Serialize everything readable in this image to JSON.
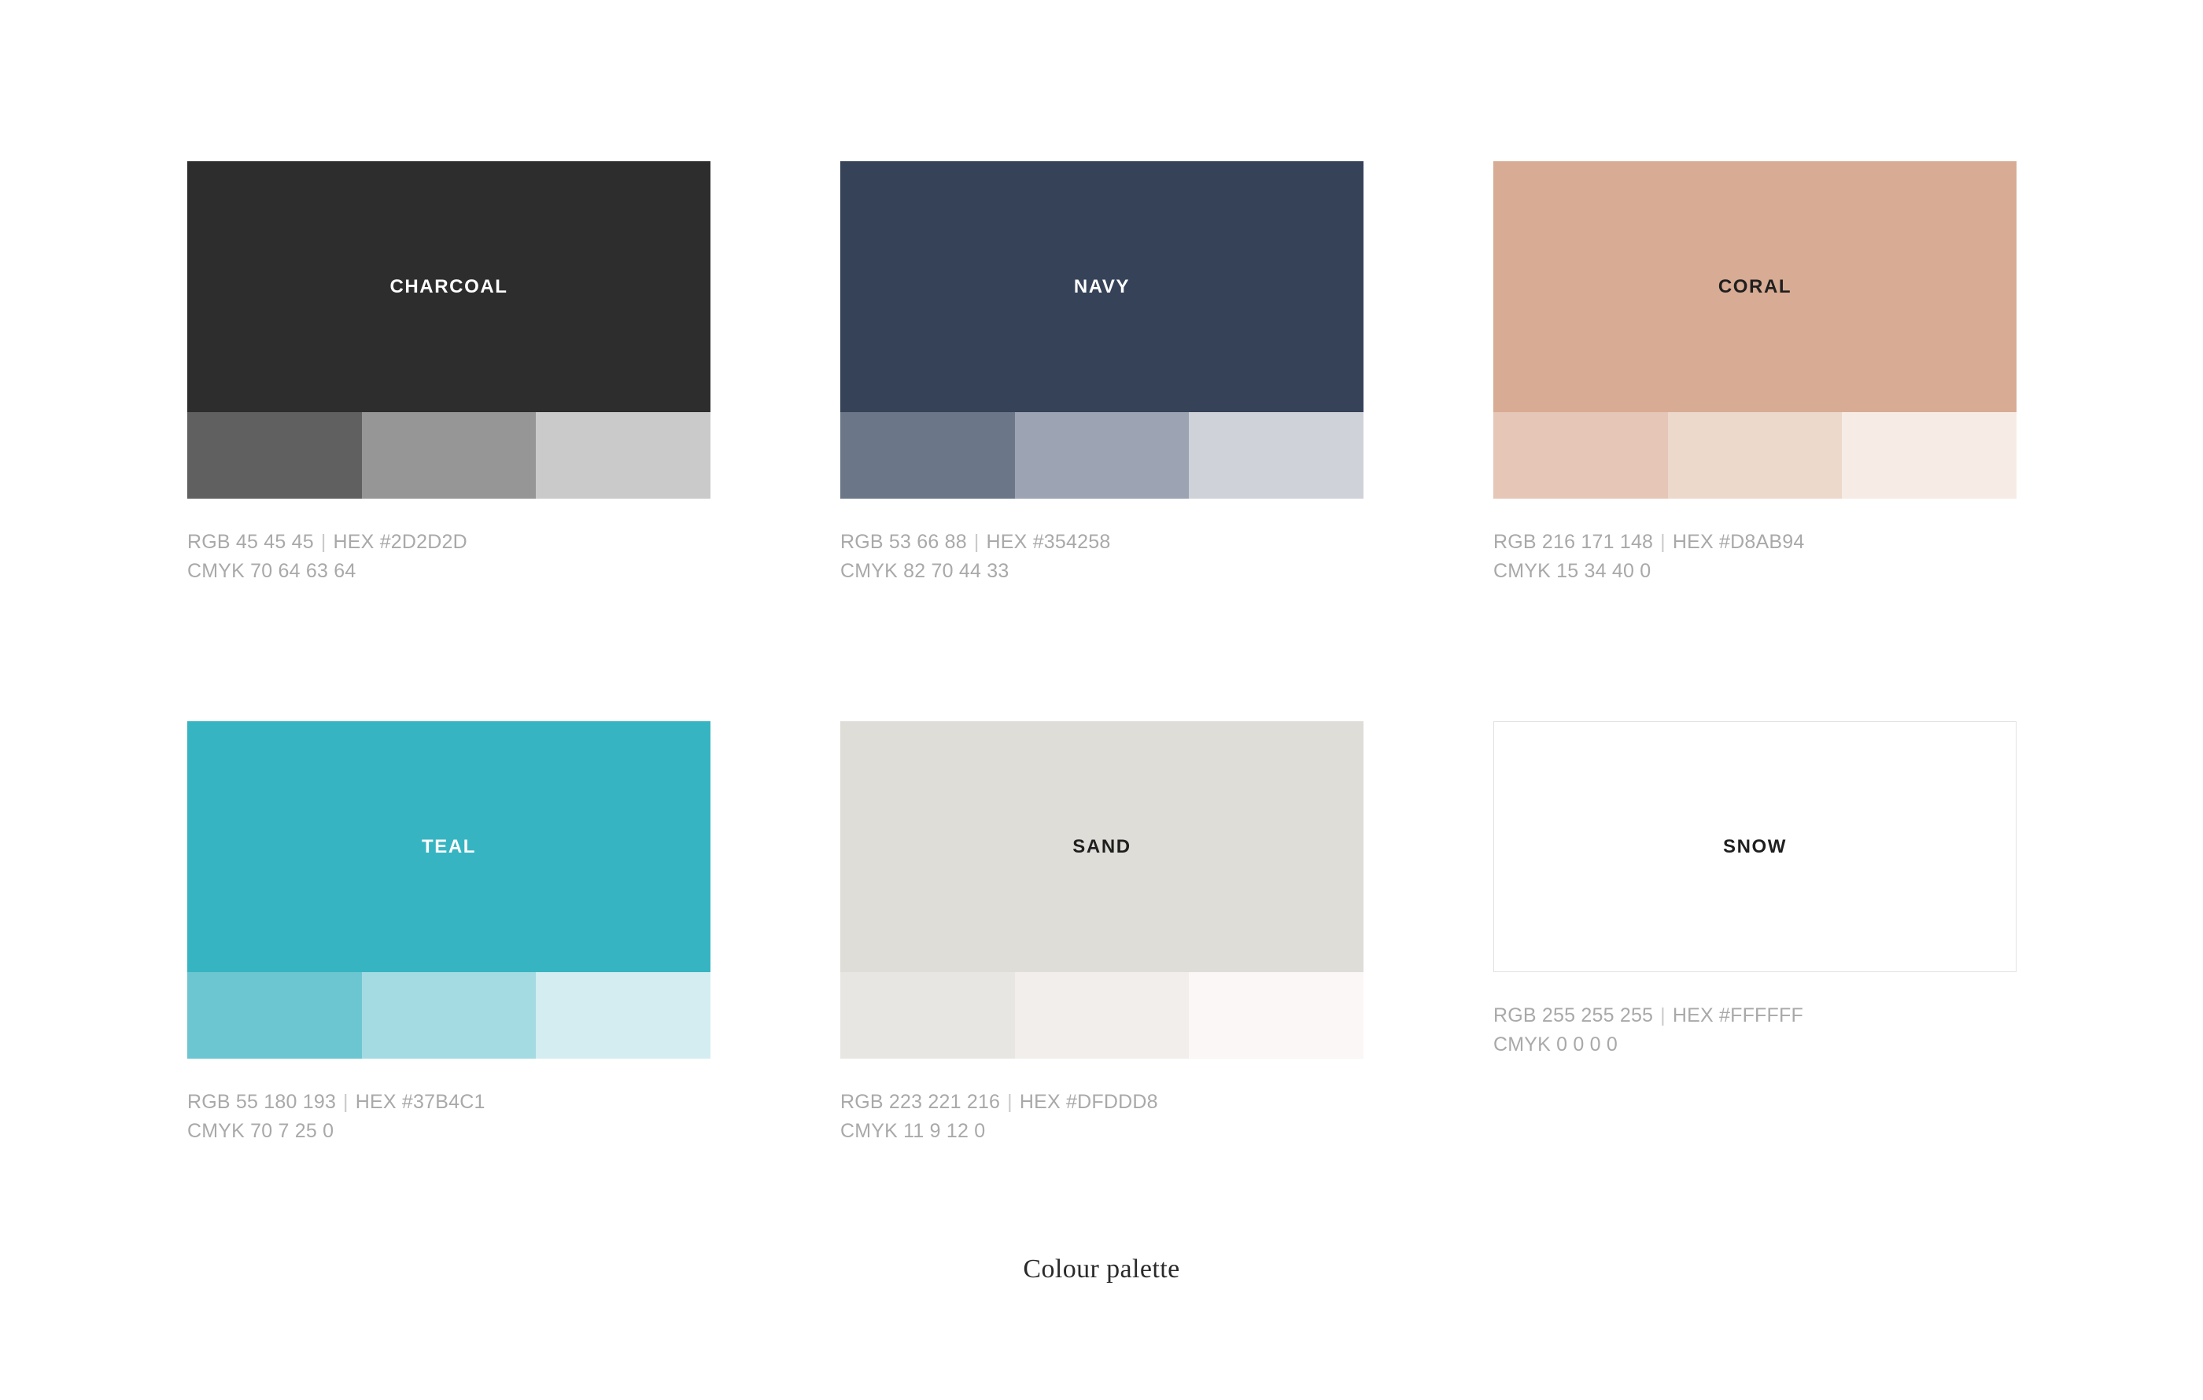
{
  "footer": {
    "caption": "Colour palette"
  },
  "palette": {
    "swatches": [
      {
        "name": "CHARCOAL",
        "main_hex": "#2D2D2D",
        "label_color": "#FFFFFF",
        "outlined": false,
        "tints": [
          "#606060",
          "#969696",
          "#CACACA"
        ],
        "rgb_label": "RGB 45 45 45",
        "hex_label": "HEX #2D2D2D",
        "cmyk_label": "CMYK 70 64 63 64",
        "divider": "|"
      },
      {
        "name": "NAVY",
        "main_hex": "#354258",
        "label_color": "#FFFFFF",
        "outlined": false,
        "tints": [
          "#6B7789",
          "#9CA3B2",
          "#CFD2D9"
        ],
        "rgb_label": "RGB 53 66 88",
        "hex_label": "HEX #354258",
        "cmyk_label": "CMYK 82 70 44 33",
        "divider": "|"
      },
      {
        "name": "CORAL",
        "main_hex": "#D8AB94",
        "label_color": "#1F1F1F",
        "outlined": false,
        "tints": [
          "#E5C6B7",
          "#EDD8CC",
          "#F7EBE5"
        ],
        "rgb_label": "RGB 216 171 148",
        "hex_label": "HEX #D8AB94",
        "cmyk_label": "CMYK 15 34 40 0",
        "divider": "|"
      },
      {
        "name": "TEAL",
        "main_hex": "#37B4C1",
        "label_color": "#FFFFFF",
        "outlined": false,
        "tints": [
          "#6CC6D2",
          "#A4DBE2",
          "#D3EDF1"
        ],
        "rgb_label": "RGB 55 180 193",
        "hex_label": "HEX #37B4C1",
        "cmyk_label": "CMYK 70 7 25 0",
        "divider": "|"
      },
      {
        "name": "SAND",
        "main_hex": "#DFDDD8",
        "label_color": "#1F1F1F",
        "outlined": false,
        "tints": [
          "#E8E6E3",
          "#F1EEEC",
          "#FAF7F6"
        ],
        "rgb_label": "RGB 223 221 216",
        "hex_label": "HEX #DFDDD8",
        "cmyk_label": "CMYK 11 9 12 0",
        "divider": "|"
      },
      {
        "name": "SNOW",
        "main_hex": "#FFFFFF",
        "label_color": "#1F1F1F",
        "outlined": true,
        "border_color": "#E2E2E2",
        "tints": [],
        "rgb_label": "RGB 255 255 255",
        "hex_label": "HEX #FFFFFF",
        "cmyk_label": "CMYK 0 0 0 0",
        "divider": "|"
      }
    ]
  }
}
